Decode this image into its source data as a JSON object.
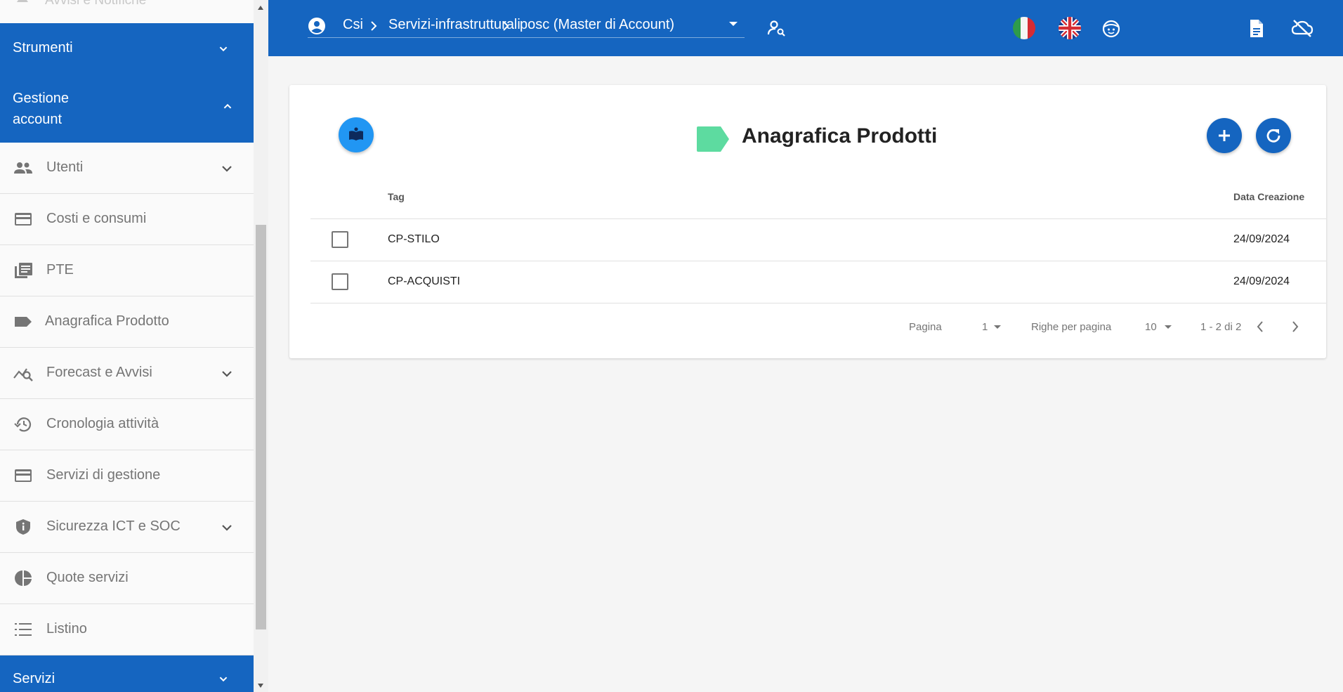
{
  "sidebar": {
    "partial_top_label": "Avvisi e Notifiche",
    "sections": {
      "strumenti": "Strumenti",
      "gestione_account": "Gestione account",
      "servizi": "Servizi"
    },
    "items": [
      {
        "label": "Utenti",
        "icon": "people-icon"
      },
      {
        "label": "Costi e consumi",
        "icon": "credit-card-icon"
      },
      {
        "label": "PTE",
        "icon": "library-books-icon"
      },
      {
        "label": "Anagrafica Prodotto",
        "icon": "label-icon"
      },
      {
        "label": "Forecast e Avvisi",
        "icon": "query-stats-icon"
      },
      {
        "label": "Cronologia attività",
        "icon": "history-icon"
      },
      {
        "label": "Servizi di gestione",
        "icon": "credit-card-icon"
      },
      {
        "label": "Sicurezza ICT e SOC",
        "icon": "shield-icon"
      },
      {
        "label": "Quote servizi",
        "icon": "pie-chart-icon"
      },
      {
        "label": "Listino",
        "icon": "list-numbered-icon"
      }
    ]
  },
  "topbar": {
    "breadcrumb": [
      "Csi",
      "Servizi-infrastrutturali",
      "posc (Master di Account)"
    ]
  },
  "main": {
    "title": "Anagrafica Prodotti",
    "table": {
      "columns": {
        "tag": "Tag",
        "date": "Data Creazione"
      },
      "rows": [
        {
          "tag": "CP-STILO",
          "date": "24/09/2024"
        },
        {
          "tag": "CP-ACQUISTI",
          "date": "24/09/2024"
        }
      ]
    },
    "pagination": {
      "page_label": "Pagina",
      "page": "1",
      "rows_label": "Righe per pagina",
      "rows_per_page": "10",
      "range": "1 - 2 di 2"
    }
  },
  "colors": {
    "primary": "#1565c0",
    "accent_blue": "#2196f3",
    "tag_green": "#5ddba0"
  }
}
